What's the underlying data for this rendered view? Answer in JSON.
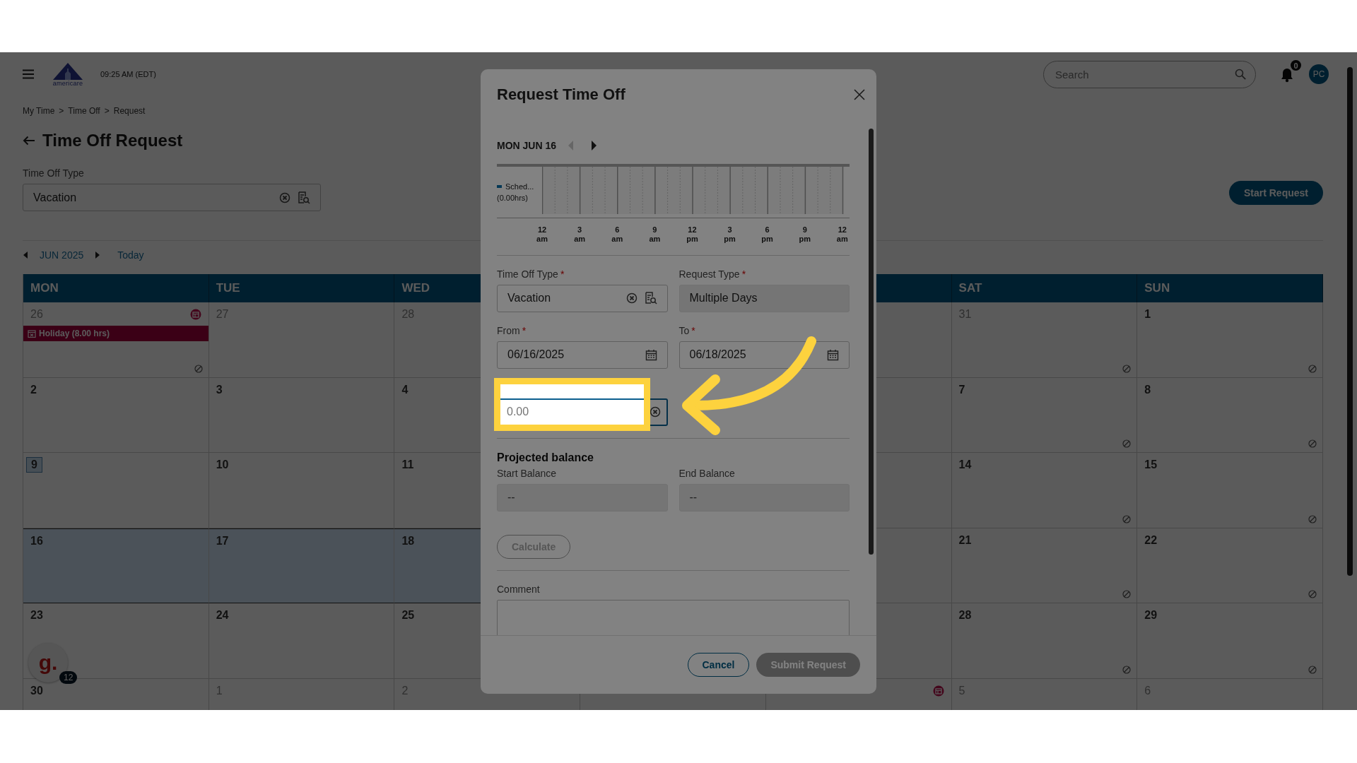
{
  "topbar": {
    "logo_text": "americare",
    "time": "09:25 AM (EDT)",
    "search": {
      "placeholder": "Search"
    },
    "notifications": "0",
    "avatar": "PC"
  },
  "breadcrumb": {
    "items": [
      "My Time",
      "Time Off",
      "Request"
    ],
    "separators": [
      ">",
      ">"
    ]
  },
  "page": {
    "title": "Time Off Request",
    "type_label": "Time Off Type",
    "type_value": "Vacation",
    "start_button": "Start Request"
  },
  "calendar_nav": {
    "month": "JUN 2025",
    "today": "Today"
  },
  "calendar": {
    "headers": {
      "mon": "MON",
      "tue": "TUE",
      "wed": "WED",
      "sat": "SAT",
      "sun": "SUN"
    },
    "weeks": [
      {
        "mon": {
          "day": "26",
          "muted": true,
          "today": false,
          "selected": false,
          "blocked": true,
          "holiday": true,
          "event": "Holiday (8.00 hrs)"
        },
        "tue": {
          "day": "27",
          "muted": true,
          "today": false,
          "selected": false,
          "blocked": false,
          "holiday": false
        },
        "wed": {
          "day": "28",
          "muted": true,
          "today": false,
          "selected": false
        },
        "sat": {
          "day": "31",
          "muted": true,
          "today": false,
          "selected": false,
          "blocked": true,
          "holiday": false
        },
        "sun": {
          "day": "1",
          "muted": false,
          "today": false,
          "selected": false,
          "blocked": true,
          "holiday": false
        }
      },
      {
        "mon": {
          "day": "2",
          "muted": false,
          "today": false,
          "selected": false,
          "blocked": false,
          "holiday": false
        },
        "tue": {
          "day": "3",
          "muted": false,
          "today": false,
          "selected": false,
          "blocked": false,
          "holiday": false
        },
        "wed": {
          "day": "4",
          "muted": false,
          "today": false,
          "selected": false
        },
        "sat": {
          "day": "7",
          "muted": false,
          "today": false,
          "selected": false,
          "blocked": true,
          "holiday": false
        },
        "sun": {
          "day": "8",
          "muted": false,
          "today": false,
          "selected": false,
          "blocked": true,
          "holiday": false
        }
      },
      {
        "mon": {
          "day": "9",
          "muted": false,
          "today": true,
          "selected": false,
          "blocked": false,
          "holiday": false
        },
        "tue": {
          "day": "10",
          "muted": false,
          "today": false,
          "selected": false,
          "blocked": false,
          "holiday": false
        },
        "wed": {
          "day": "11",
          "muted": false,
          "today": false,
          "selected": false
        },
        "sat": {
          "day": "14",
          "muted": false,
          "today": false,
          "selected": false,
          "blocked": true,
          "holiday": false
        },
        "sun": {
          "day": "15",
          "muted": false,
          "today": false,
          "selected": false,
          "blocked": true,
          "holiday": false
        }
      },
      {
        "mon": {
          "day": "16",
          "muted": false,
          "today": false,
          "selected": true,
          "blocked": false,
          "holiday": false
        },
        "tue": {
          "day": "17",
          "muted": false,
          "today": false,
          "selected": true,
          "blocked": false,
          "holiday": false
        },
        "wed": {
          "day": "18",
          "muted": false,
          "today": false,
          "selected": true
        },
        "sat": {
          "day": "21",
          "muted": false,
          "today": false,
          "selected": false,
          "blocked": true,
          "holiday": false
        },
        "sun": {
          "day": "22",
          "muted": false,
          "today": false,
          "selected": false,
          "blocked": true,
          "holiday": false
        }
      },
      {
        "mon": {
          "day": "23",
          "muted": false,
          "today": false,
          "selected": false,
          "blocked": false,
          "holiday": false
        },
        "tue": {
          "day": "24",
          "muted": false,
          "today": false,
          "selected": false,
          "blocked": false,
          "holiday": false
        },
        "wed": {
          "day": "25",
          "muted": false,
          "today": false,
          "selected": false
        },
        "sat": {
          "day": "28",
          "muted": false,
          "today": false,
          "selected": false,
          "blocked": true,
          "holiday": false
        },
        "sun": {
          "day": "29",
          "muted": false,
          "today": false,
          "selected": false,
          "blocked": true,
          "holiday": false
        }
      },
      {
        "mon": {
          "day": "30",
          "muted": false,
          "today": false,
          "selected": false,
          "holiday": false
        },
        "tue": {
          "day": "1",
          "muted": true,
          "today": false,
          "selected": false,
          "holiday": false
        },
        "wed": {
          "day": "2",
          "muted": true,
          "today": false,
          "selected": false
        },
        "fri": {
          "selected": false,
          "holiday": true
        },
        "sat": {
          "day": "5",
          "muted": true,
          "today": false,
          "selected": false,
          "holiday": false
        },
        "sun": {
          "day": "6",
          "muted": true,
          "today": false,
          "selected": false,
          "holiday": false
        }
      }
    ]
  },
  "help": {
    "letter": "g.",
    "count": "12"
  },
  "modal": {
    "title": "Request Time Off",
    "day_nav": {
      "label": "MON JUN 16",
      "prev_disabled": true
    },
    "timeline": {
      "legend": [
        {
          "label": "Sched...",
          "hours": "(0.00hrs)"
        }
      ],
      "ticks": [
        "12 am",
        "3 am",
        "6 am",
        "9 am",
        "12 pm",
        "3 pm",
        "6 pm",
        "9 pm",
        "12 am"
      ]
    },
    "fields": [
      {
        "kind": "lookup",
        "label": "Time Off Type",
        "required_mark": "*",
        "value": "Vacation",
        "disabled": false,
        "focused": false
      },
      {
        "kind": "text",
        "label": "Request Type",
        "required_mark": "*",
        "value": "Multiple Days",
        "disabled": true,
        "focused": false
      },
      {
        "kind": "date",
        "label": "From",
        "required_mark": "*",
        "value": "06/16/2025",
        "disabled": false,
        "focused": false
      },
      {
        "kind": "date",
        "label": "To",
        "required_mark": "*",
        "value": "06/18/2025",
        "disabled": false,
        "focused": false
      },
      {
        "kind": "number",
        "placeholder": "0.00",
        "disabled": false,
        "focused": true
      }
    ],
    "projected_title": "Projected balance",
    "balances": [
      {
        "label": "Start Balance",
        "value": "--"
      },
      {
        "label": "End Balance",
        "value": "--"
      }
    ],
    "calculate": {
      "label": "Calculate",
      "disabled": true
    },
    "comment": {
      "label": "Comment"
    },
    "buttons": [
      {
        "kind": "secondary",
        "label": "Cancel",
        "disabled": false
      },
      {
        "kind": "primary",
        "label": "Submit Request",
        "disabled": true
      }
    ]
  }
}
